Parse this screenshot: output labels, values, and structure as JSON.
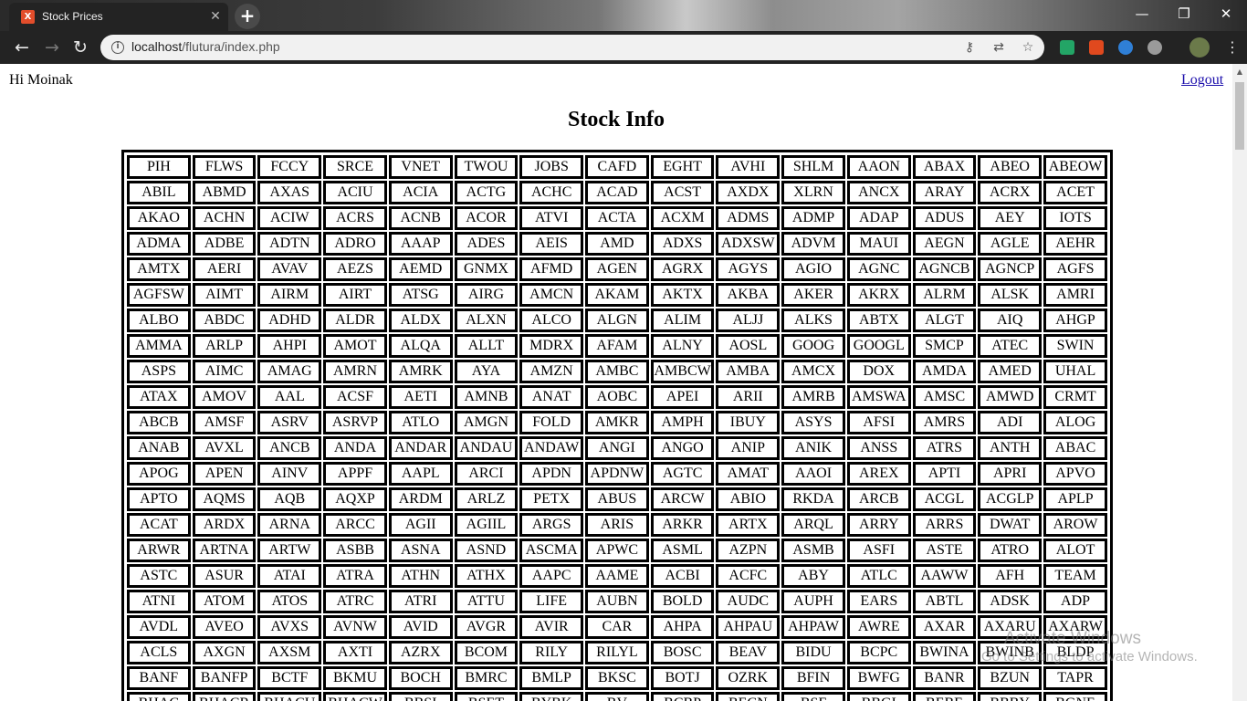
{
  "browser": {
    "tab_title": "Stock Prices",
    "tab_favicon": "X",
    "url_host": "localhost",
    "url_path": "/flutura/index.php"
  },
  "header": {
    "greeting": "Hi Moinak",
    "logout_label": "Logout",
    "title": "Stock Info"
  },
  "stocks": [
    [
      "PIH",
      "FLWS",
      "FCCY",
      "SRCE",
      "VNET",
      "TWOU",
      "JOBS",
      "CAFD",
      "EGHT",
      "AVHI",
      "SHLM",
      "AAON",
      "ABAX",
      "ABEO",
      "ABEOW"
    ],
    [
      "ABIL",
      "ABMD",
      "AXAS",
      "ACIU",
      "ACIA",
      "ACTG",
      "ACHC",
      "ACAD",
      "ACST",
      "AXDX",
      "XLRN",
      "ANCX",
      "ARAY",
      "ACRX",
      "ACET"
    ],
    [
      "AKAO",
      "ACHN",
      "ACIW",
      "ACRS",
      "ACNB",
      "ACOR",
      "ATVI",
      "ACTA",
      "ACXM",
      "ADMS",
      "ADMP",
      "ADAP",
      "ADUS",
      "AEY",
      "IOTS"
    ],
    [
      "ADMA",
      "ADBE",
      "ADTN",
      "ADRO",
      "AAAP",
      "ADES",
      "AEIS",
      "AMD",
      "ADXS",
      "ADXSW",
      "ADVM",
      "MAUI",
      "AEGN",
      "AGLE",
      "AEHR"
    ],
    [
      "AMTX",
      "AERI",
      "AVAV",
      "AEZS",
      "AEMD",
      "GNMX",
      "AFMD",
      "AGEN",
      "AGRX",
      "AGYS",
      "AGIO",
      "AGNC",
      "AGNCB",
      "AGNCP",
      "AGFS"
    ],
    [
      "AGFSW",
      "AIMT",
      "AIRM",
      "AIRT",
      "ATSG",
      "AIRG",
      "AMCN",
      "AKAM",
      "AKTX",
      "AKBA",
      "AKER",
      "AKRX",
      "ALRM",
      "ALSK",
      "AMRI"
    ],
    [
      "ALBO",
      "ABDC",
      "ADHD",
      "ALDR",
      "ALDX",
      "ALXN",
      "ALCO",
      "ALGN",
      "ALIM",
      "ALJJ",
      "ALKS",
      "ABTX",
      "ALGT",
      "AIQ",
      "AHGP"
    ],
    [
      "AMMA",
      "ARLP",
      "AHPI",
      "AMOT",
      "ALQA",
      "ALLT",
      "MDRX",
      "AFAM",
      "ALNY",
      "AOSL",
      "GOOG",
      "GOOGL",
      "SMCP",
      "ATEC",
      "SWIN"
    ],
    [
      "ASPS",
      "AIMC",
      "AMAG",
      "AMRN",
      "AMRK",
      "AYA",
      "AMZN",
      "AMBC",
      "AMBCW",
      "AMBA",
      "AMCX",
      "DOX",
      "AMDA",
      "AMED",
      "UHAL"
    ],
    [
      "ATAX",
      "AMOV",
      "AAL",
      "ACSF",
      "AETI",
      "AMNB",
      "ANAT",
      "AOBC",
      "APEI",
      "ARII",
      "AMRB",
      "AMSWA",
      "AMSC",
      "AMWD",
      "CRMT"
    ],
    [
      "ABCB",
      "AMSF",
      "ASRV",
      "ASRVP",
      "ATLO",
      "AMGN",
      "FOLD",
      "AMKR",
      "AMPH",
      "IBUY",
      "ASYS",
      "AFSI",
      "AMRS",
      "ADI",
      "ALOG"
    ],
    [
      "ANAB",
      "AVXL",
      "ANCB",
      "ANDA",
      "ANDAR",
      "ANDAU",
      "ANDAW",
      "ANGI",
      "ANGO",
      "ANIP",
      "ANIK",
      "ANSS",
      "ATRS",
      "ANTH",
      "ABAC"
    ],
    [
      "APOG",
      "APEN",
      "AINV",
      "APPF",
      "AAPL",
      "ARCI",
      "APDN",
      "APDNW",
      "AGTC",
      "AMAT",
      "AAOI",
      "AREX",
      "APTI",
      "APRI",
      "APVO"
    ],
    [
      "APTO",
      "AQMS",
      "AQB",
      "AQXP",
      "ARDM",
      "ARLZ",
      "PETX",
      "ABUS",
      "ARCW",
      "ABIO",
      "RKDA",
      "ARCB",
      "ACGL",
      "ACGLP",
      "APLP"
    ],
    [
      "ACAT",
      "ARDX",
      "ARNA",
      "ARCC",
      "AGII",
      "AGIIL",
      "ARGS",
      "ARIS",
      "ARKR",
      "ARTX",
      "ARQL",
      "ARRY",
      "ARRS",
      "DWAT",
      "AROW"
    ],
    [
      "ARWR",
      "ARTNA",
      "ARTW",
      "ASBB",
      "ASNA",
      "ASND",
      "ASCMA",
      "APWC",
      "ASML",
      "AZPN",
      "ASMB",
      "ASFI",
      "ASTE",
      "ATRO",
      "ALOT"
    ],
    [
      "ASTC",
      "ASUR",
      "ATAI",
      "ATRA",
      "ATHN",
      "ATHX",
      "AAPC",
      "AAME",
      "ACBI",
      "ACFC",
      "ABY",
      "ATLC",
      "AAWW",
      "AFH",
      "TEAM"
    ],
    [
      "ATNI",
      "ATOM",
      "ATOS",
      "ATRC",
      "ATRI",
      "ATTU",
      "LIFE",
      "AUBN",
      "BOLD",
      "AUDC",
      "AUPH",
      "EARS",
      "ABTL",
      "ADSK",
      "ADP"
    ],
    [
      "AVDL",
      "AVEO",
      "AVXS",
      "AVNW",
      "AVID",
      "AVGR",
      "AVIR",
      "CAR",
      "AHPA",
      "AHPAU",
      "AHPAW",
      "AWRE",
      "AXAR",
      "AXARU",
      "AXARW"
    ],
    [
      "ACLS",
      "AXGN",
      "AXSM",
      "AXTI",
      "AZRX",
      "BCOM",
      "RILY",
      "RILYL",
      "BOSC",
      "BEAV",
      "BIDU",
      "BCPC",
      "BWINA",
      "BWINB",
      "BLDP"
    ],
    [
      "BANF",
      "BANFP",
      "BCTF",
      "BKMU",
      "BOCH",
      "BMRC",
      "BMLP",
      "BKSC",
      "BOTJ",
      "OZRK",
      "BFIN",
      "BWFG",
      "BANR",
      "BZUN",
      "TAPR"
    ],
    [
      "BHAC",
      "BHACR",
      "BHACU",
      "BHACW",
      "BBSI",
      "BSET",
      "BYBK",
      "BV",
      "BCBP",
      "BECN",
      "BSF",
      "BBGI",
      "BEBE",
      "BBBY",
      "BGNE"
    ]
  ],
  "watermark": {
    "line1": "Activate Windows",
    "line2": "Go to Settings to activate Windows."
  },
  "colors": {
    "tab_bg": "#232323",
    "toolbar_bg": "#232323",
    "link": "#1a0dab"
  }
}
